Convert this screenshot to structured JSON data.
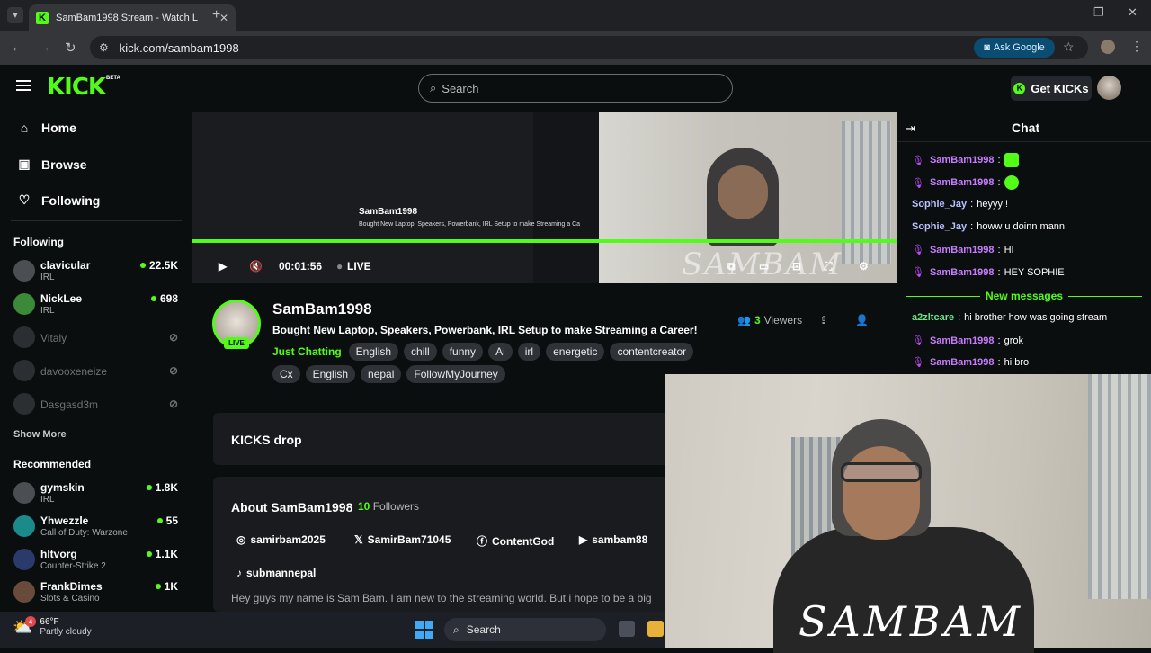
{
  "browser": {
    "tab_title": "SamBam1998 Stream - Watch L",
    "tab_favicon": "K",
    "url": "kick.com/sambam1998",
    "ask_google": "Ask Google"
  },
  "header": {
    "logo": "KICK",
    "beta": "BETA",
    "search_placeholder": "Search",
    "get_kicks": "Get KICKs"
  },
  "sidebar": {
    "nav": [
      {
        "label": "Home",
        "icon": "home-icon"
      },
      {
        "label": "Browse",
        "icon": "browse-icon"
      },
      {
        "label": "Following",
        "icon": "heart-icon"
      }
    ],
    "following_title": "Following",
    "following": [
      {
        "name": "clavicular",
        "category": "IRL",
        "viewers": "22.5K",
        "live": true
      },
      {
        "name": "NickLee",
        "category": "IRL",
        "viewers": "698",
        "live": true
      },
      {
        "name": "Vitaly",
        "live": false
      },
      {
        "name": "davooxeneize",
        "live": false
      },
      {
        "name": "Dasgasd3m",
        "live": false
      }
    ],
    "show_more": "Show More",
    "recommended_title": "Recommended",
    "recommended": [
      {
        "name": "gymskin",
        "category": "IRL",
        "viewers": "1.8K"
      },
      {
        "name": "Yhwezzle",
        "category": "Call of Duty: Warzone",
        "viewers": "55"
      },
      {
        "name": "hltvorg",
        "category": "Counter-Strike 2",
        "viewers": "1.1K"
      },
      {
        "name": "FrankDimes",
        "category": "Slots & Casino",
        "viewers": "1K"
      }
    ]
  },
  "player": {
    "time": "00:01:56",
    "live": "LIVE",
    "watermark": "SAMBAM",
    "mini_title": "SamBam1998",
    "mini_sub": "Bought New Laptop, Speakers, Powerbank, IRL Setup to make Streaming a Ca"
  },
  "stream": {
    "name": "SamBam1998",
    "title": "Bought New Laptop, Speakers, Powerbank, IRL Setup to make Streaming a Career!",
    "live_badge": "LIVE",
    "category": "Just Chatting",
    "tags_row1": [
      "English",
      "chill",
      "funny",
      "Ai",
      "irl",
      "energetic",
      "contentcreator"
    ],
    "tags_row2": [
      "Cx",
      "English",
      "nepal",
      "FollowMyJourney"
    ],
    "viewers_count": "3",
    "viewers_label": "Viewers"
  },
  "kicks_drop": "KICKS drop",
  "about": {
    "title": "About SamBam1998",
    "followers_count": "10",
    "followers_label": "Followers",
    "socials": [
      {
        "label": "samirbam2025",
        "icon": "instagram-icon"
      },
      {
        "label": "SamirBam71045",
        "icon": "x-icon"
      },
      {
        "label": "ContentGod",
        "icon": "facebook-icon"
      },
      {
        "label": "sambam88",
        "icon": "youtube-icon"
      },
      {
        "label": "submannepal",
        "icon": "tiktok-icon"
      }
    ],
    "bio": "Hey guys my name is Sam Bam. I am new to the streaming world. But i hope to be a big"
  },
  "chat": {
    "title": "Chat",
    "messages": [
      {
        "user": "SamBam1998",
        "text": "",
        "mod": true,
        "emote": true
      },
      {
        "user": "SamBam1998",
        "text": "",
        "mod": true,
        "emote": true
      },
      {
        "user": "Sophie_Jay",
        "text": "heyyy!!",
        "mod": false
      },
      {
        "user": "Sophie_Jay",
        "text": "howw u doinn mann",
        "mod": false
      },
      {
        "user": "SamBam1998",
        "text": "HI",
        "mod": true
      },
      {
        "user": "SamBam1998",
        "text": "HEY SOPHIE",
        "mod": true
      }
    ],
    "new_messages": "New messages",
    "messages_after": [
      {
        "user": "a2zltcare",
        "text": "hi brother how was going stream",
        "mod": false
      },
      {
        "user": "SamBam1998",
        "text": "grok",
        "mod": true
      },
      {
        "user": "SamBam1998",
        "text": "hi bro",
        "mod": true
      }
    ]
  },
  "webcam": {
    "watermark": "SAMBAM"
  },
  "taskbar": {
    "temp": "66°F",
    "weather": "Partly cloudy",
    "notif": "4",
    "search": "Search"
  },
  "colors": {
    "accent": "#53fc18",
    "mod_name": "#c77cff"
  }
}
